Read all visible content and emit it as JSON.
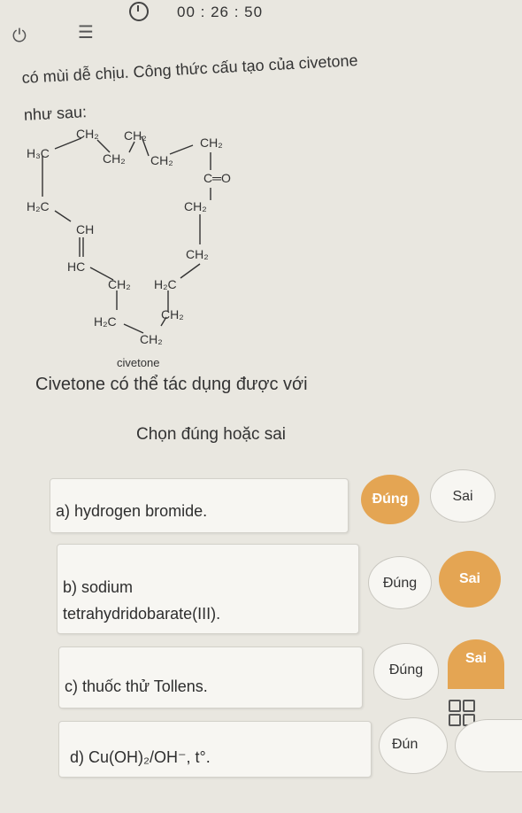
{
  "status_bar": {
    "timer": "00 : 26 : 50"
  },
  "intro": {
    "line1": "có mùi dễ chịu. Công thức cấu tạo của civetone",
    "line2": "như sau:"
  },
  "structure": {
    "caption": "civetone",
    "labels": {
      "h3c_top": "H₃C",
      "ch2_a": "CH₂",
      "ch2_b": "CH₂",
      "ch2_c": "CH₂",
      "ch2_d": "CH₂",
      "ch2_e": "CH₂",
      "c_o": "C═O",
      "ch2_f": "CH₂",
      "ch2_g": "CH₂",
      "h2c_left": "H₂C",
      "ch_top": "CH",
      "hc": "HC",
      "ch2_h": "CH₂",
      "h2c_mid": "H₂C",
      "h2c_low": "H₂C",
      "ch2_i": "CH₂",
      "ch2_j": "CH₂"
    }
  },
  "question": "Civetone có thể tác dụng được với",
  "instruction": "Chọn đúng hoặc sai",
  "options": [
    {
      "label": "a) hydrogen bromide.",
      "true_label": "Đúng",
      "false_label": "Sai",
      "selected": "true"
    },
    {
      "label_line1": "b) sodium",
      "label_line2": "tetrahydridobarate(III).",
      "true_label": "Đúng",
      "false_label": "Sai",
      "selected": "false"
    },
    {
      "label": "c) thuốc thử Tollens.",
      "true_label": "Đúng",
      "false_label": "Sai",
      "selected": "false"
    },
    {
      "label": "d) Cu(OH)₂/OH⁻, t°.",
      "true_label": "Đún",
      "selected": "none"
    }
  ],
  "colors": {
    "selected": "#e4a553",
    "card": "#f7f6f2",
    "background": "#e9e7e0"
  }
}
